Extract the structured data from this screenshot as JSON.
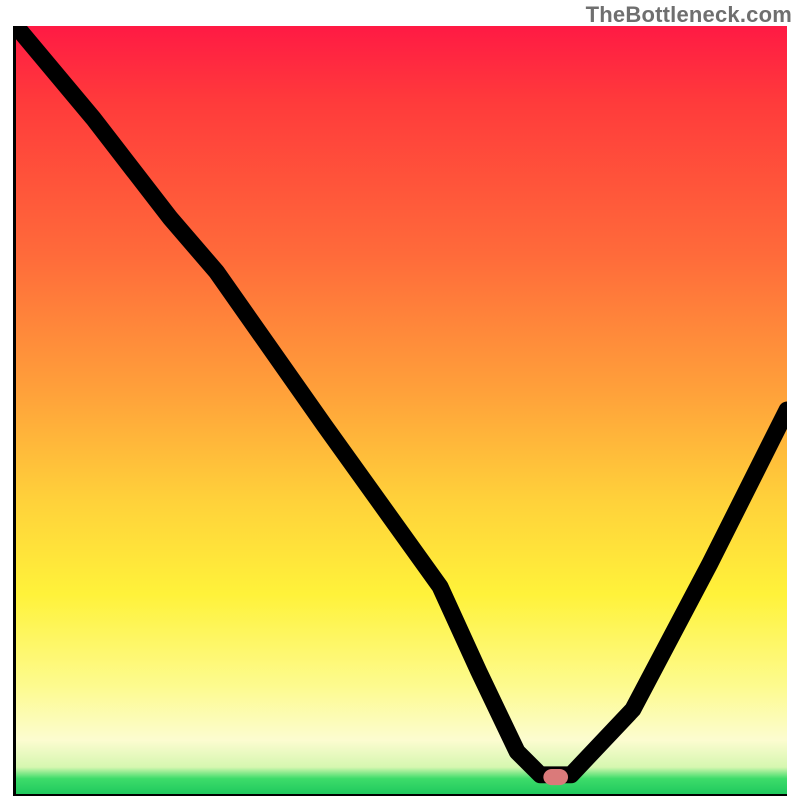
{
  "watermark": "TheBottleneck.com",
  "chart_data": {
    "type": "line",
    "title": "",
    "xlabel": "",
    "ylabel": "",
    "xlim": [
      0,
      100
    ],
    "ylim": [
      0,
      100
    ],
    "x": [
      0,
      10,
      20,
      26,
      40,
      55,
      60,
      65,
      68,
      72,
      80,
      90,
      100
    ],
    "values": [
      100,
      88,
      75,
      68,
      48,
      27,
      16,
      5.5,
      2.5,
      2.5,
      11,
      30,
      50
    ],
    "marker": {
      "x": 70,
      "y": 2.2
    },
    "annotations": []
  },
  "colors": {
    "curve": "#000000",
    "marker": "#da7a7a",
    "gradient_top": "#ff1a44",
    "gradient_bottom": "#1fc95e"
  }
}
